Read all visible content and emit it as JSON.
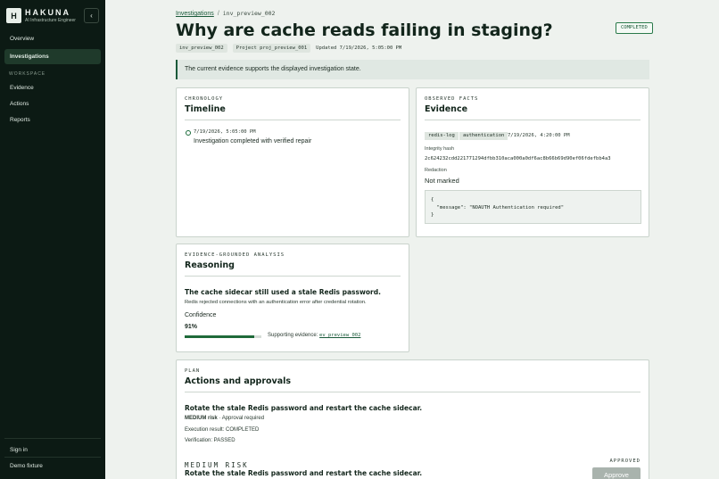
{
  "brand": {
    "mark": "H",
    "name": "HAKUNA",
    "subtitle": "AI Infrastructure Engineer",
    "collapse_icon": "‹"
  },
  "sidebar": {
    "items": [
      {
        "label": "Overview"
      },
      {
        "label": "Investigations",
        "active": true
      },
      {
        "label": "Evidence"
      },
      {
        "label": "Actions"
      },
      {
        "label": "Reports"
      }
    ],
    "section_label": "WORKSPACE",
    "footer": {
      "sign_in": "Sign in",
      "demo": "Demo fixture"
    }
  },
  "breadcrumb": {
    "parent": "Investigations",
    "separator": "/",
    "current": "inv_preview_002"
  },
  "page": {
    "title": "Why are cache reads failing in staging?",
    "status": "COMPLETED",
    "id_chip": "inv_preview_002",
    "project_chip": "Project  proj_preview_001",
    "updated": "Updated  7/19/2026, 5:05:00 PM",
    "banner": "The current evidence supports the displayed investigation state."
  },
  "timeline": {
    "eyebrow": "CHRONOLOGY",
    "title": "Timeline",
    "events": [
      {
        "time": "7/19/2026, 5:05:00 PM",
        "text": "Investigation completed with verified repair"
      }
    ]
  },
  "evidence": {
    "eyebrow": "OBSERVED FACTS",
    "title": "Evidence",
    "source_chip": "redis-log",
    "kind_chip": "authentication",
    "time": "7/19/2026, 4:20:00 PM",
    "hash_label": "Integrity hash",
    "hash": "2c624232cdd221771294dfbb310aca000a0df6ac8b66b69d90ef06fdefbb4a3",
    "redaction_label": "Redaction",
    "redaction_value": "Not marked",
    "json": "{\n  \"message\": \"NOAUTH Authentication required\"\n}"
  },
  "reasoning": {
    "eyebrow": "EVIDENCE-GROUNDED ANALYSIS",
    "title": "Reasoning",
    "headline": "The cache sidecar still used a stale Redis password.",
    "detail": "Redis rejected connections with an authentication error after credential rotation.",
    "confidence_label": "Confidence",
    "confidence_value": "91%",
    "confidence_fraction": 0.91,
    "support_label": "Supporting evidence:",
    "support_link": "ev_preview_002"
  },
  "actions": {
    "eyebrow": "PLAN",
    "title": "Actions and approvals",
    "action_title": "Rotate the stale Redis password and restart the cache sidecar.",
    "risk_prefix": "MEDIUM risk",
    "risk_suffix": " · Approval required",
    "execution": "Execution result: COMPLETED",
    "verification": "Verification: PASSED",
    "approval_risk": "MEDIUM RISK",
    "approval_title": "Rotate the stale Redis password and restart the cache sidecar.",
    "approval_status": "APPROVED",
    "approve_button": "Approve"
  }
}
